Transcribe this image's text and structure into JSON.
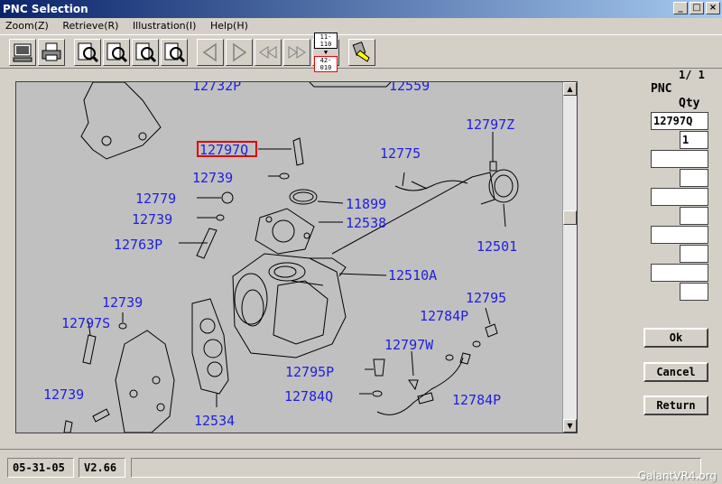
{
  "window": {
    "title": "PNC Selection",
    "controls": [
      "_",
      "□",
      "×"
    ]
  },
  "menu": [
    "Zoom(Z)",
    "Retrieve(R)",
    "Illustration(I)",
    "Help(H)"
  ],
  "toolbar": {
    "range_top": "11-110",
    "range_bottom": "42-010"
  },
  "diagram": {
    "selected": "12797Q",
    "labels": [
      "12732P",
      "12559",
      "12797Q",
      "12797Z",
      "12775",
      "12739",
      "12779",
      "11899",
      "12739",
      "12538",
      "12763P",
      "12501",
      "12510A",
      "12739",
      "12795",
      "12797S",
      "12784P",
      "12797W",
      "12795P",
      "12739",
      "12784Q",
      "12784P",
      "12534"
    ]
  },
  "panel": {
    "page": "1/ 1",
    "pnc_label": "PNC",
    "qty_label": "Qty",
    "pnc_value": "12797Q",
    "qty_value": "1",
    "ok": "Ok",
    "cancel": "Cancel",
    "return": "Return"
  },
  "status": {
    "date": "05-31-05",
    "version": "V2.66",
    "message": ""
  },
  "watermark": "GalantVR4.org"
}
